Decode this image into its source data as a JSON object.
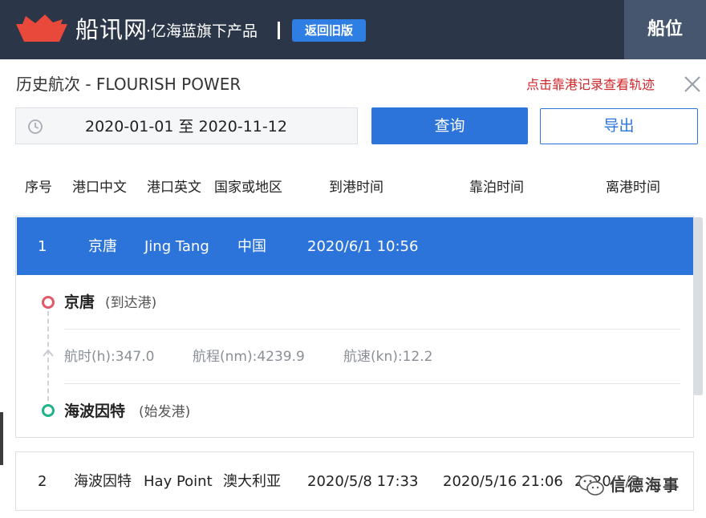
{
  "header": {
    "brand": "船讯网",
    "subtitle": "·亿海蓝旗下产品",
    "old_version_button": "返回旧版",
    "berth_tab": "船位"
  },
  "page": {
    "title": "历史航次 - FLOURISH POWER",
    "hint_link": "点击靠港记录查看轨迹"
  },
  "search": {
    "date_range": "2020-01-01 至 2020-11-12",
    "query_button": "查询",
    "export_button": "导出"
  },
  "table": {
    "columns": [
      "序号",
      "港口中文",
      "港口英文",
      "国家或地区",
      "到港时间",
      "靠泊时间",
      "离港时间"
    ],
    "rows": [
      {
        "index": "1",
        "port_cn": "京唐",
        "port_en": "Jing Tang",
        "country": "中国",
        "arrival": "2020/6/1 10:56",
        "berthing": "",
        "departure": "",
        "selected": true,
        "detail": {
          "arrival_port": "京唐",
          "arrival_tag": "(到达港)",
          "voyage_hours": "航时(h):347.0",
          "voyage_distance": "航程(nm):4239.9",
          "voyage_speed": "航速(kn):12.2",
          "departure_port": "海波因特",
          "departure_tag": "(始发港)"
        }
      },
      {
        "index": "2",
        "port_cn": "海波因特",
        "port_en": "Hay Point",
        "country": "澳大利亚",
        "arrival": "2020/5/8 17:33",
        "berthing": "2020/5/16 21:06",
        "departure": "2020/5/23 23:14",
        "selected": false
      }
    ]
  },
  "watermark": {
    "text": "信德海事"
  },
  "colors": {
    "header_bg": "#2b3648",
    "accent_blue": "#2d74da",
    "hint_red": "#d0252a",
    "logo_red": "#e9493a",
    "arrival_dot": "#e05a6a",
    "departure_dot": "#1fb389"
  },
  "icons": {
    "logo": "ship-boat-icon",
    "close": "close-icon",
    "clock": "clock-icon",
    "route_arrow": "arrow-up-icon",
    "wechat": "wechat-icon"
  }
}
